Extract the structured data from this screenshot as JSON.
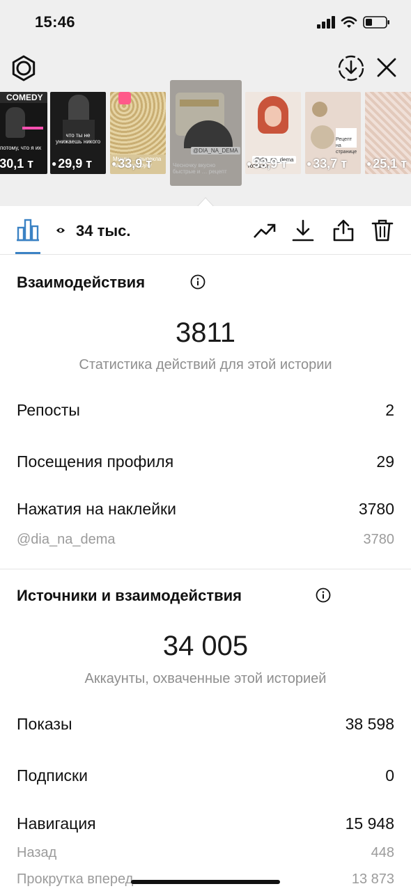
{
  "status_bar": {
    "time": "15:46"
  },
  "stories": [
    {
      "views": "30,1 т",
      "caption": "…потому, что я их",
      "tag": "COMEDY"
    },
    {
      "views": "29,9 т",
      "caption": "что ты не унижаешь никого"
    },
    {
      "views": "33,9 т",
      "caption": "Мммм, … выпекла на скорую руку"
    },
    {
      "views": "",
      "caption": "Чесночку вкусно быстрые и … рецепт",
      "tag": "@DIA_NA_DEMA"
    },
    {
      "views": "33,9 т",
      "caption": "готовить",
      "tag": "@dia_na_dema"
    },
    {
      "views": "33,7 т",
      "caption": "Рецепт на странице"
    },
    {
      "views": "25,1 т",
      "caption": ""
    }
  ],
  "toolbar": {
    "views": "34 тыс."
  },
  "interactions": {
    "title": "Взаимодействия",
    "total": "3811",
    "caption": "Статистика действий для этой истории",
    "rows": [
      {
        "label": "Репосты",
        "value": "2"
      },
      {
        "label": "Посещения профиля",
        "value": "29"
      },
      {
        "label": "Нажатия на наклейки",
        "value": "3780"
      }
    ],
    "sticker": {
      "label": "@dia_na_dema",
      "value": "3780"
    }
  },
  "reach": {
    "title": "Источники и взаимодействия",
    "total": "34 005",
    "caption": "Аккаунты, охваченные этой историей",
    "rows": [
      {
        "label": "Показы",
        "value": "38 598"
      },
      {
        "label": "Подписки",
        "value": "0"
      },
      {
        "label": "Навигация",
        "value": "15 948"
      }
    ],
    "nav_rows": [
      {
        "label": "Назад",
        "value": "448"
      },
      {
        "label": "Прокрутка вперед",
        "value": "13 873"
      }
    ]
  },
  "colors": {
    "accent": "#3b82c4",
    "top_background": "#efefef",
    "secondary_text": "#8e8e8e"
  },
  "icons": [
    "settings-gear-icon",
    "download-circle-icon",
    "close-icon",
    "bar-chart-icon",
    "eye-icon",
    "trend-up-icon",
    "download-icon",
    "share-icon",
    "trash-icon",
    "info-icon"
  ]
}
